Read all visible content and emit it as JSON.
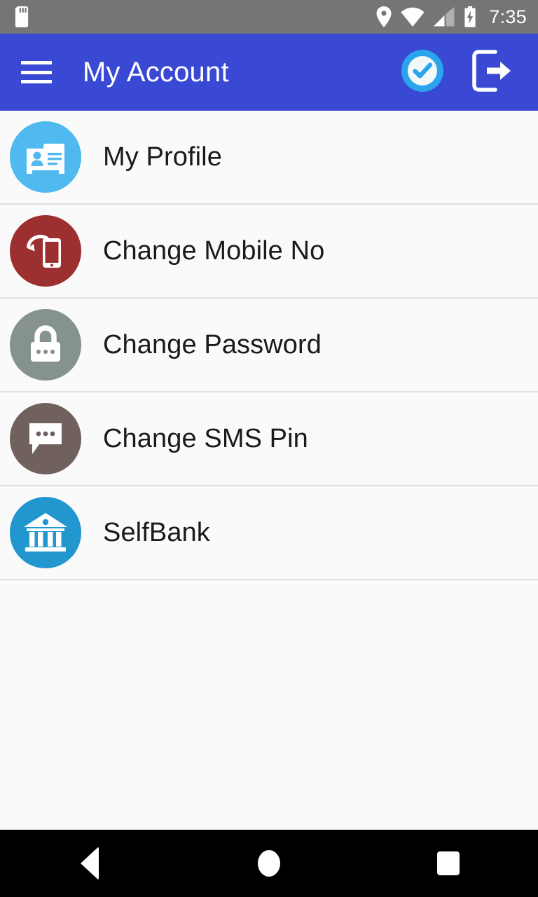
{
  "status_bar": {
    "background_color": "#757575",
    "time": "7:35",
    "left_icons": [
      {
        "name": "sd-card-icon",
        "label": "SD card"
      }
    ],
    "right_icons": [
      {
        "name": "location-pin-icon",
        "label": "Location"
      },
      {
        "name": "wifi-icon",
        "label": "Wi-Fi"
      },
      {
        "name": "cellular-signal-icon",
        "label": "Cellular signal"
      },
      {
        "name": "battery-charging-icon",
        "label": "Battery charging"
      }
    ]
  },
  "app_bar": {
    "background_color": "#3949d3",
    "title": "My Account",
    "menu_icon": "hamburger-menu-icon",
    "actions": [
      {
        "name": "verified-check-button",
        "icon": "check-circle-icon",
        "color": "#29a8ef"
      },
      {
        "name": "logout-button",
        "icon": "exit-to-app-icon",
        "color": "#ffffff"
      }
    ]
  },
  "list": {
    "background_color": "#fafafa",
    "divider_color": "#e0e0e0",
    "items": [
      {
        "label": "My Profile",
        "icon": "contact-card-icon",
        "icon_bg": "#4fb9f0",
        "name": "list-item-my-profile"
      },
      {
        "label": "Change Mobile No",
        "icon": "phone-rotate-icon",
        "icon_bg": "#9c2f30",
        "name": "list-item-change-mobile-no"
      },
      {
        "label": "Change Password",
        "icon": "lock-icon",
        "icon_bg": "#869290",
        "name": "list-item-change-password"
      },
      {
        "label": "Change SMS Pin",
        "icon": "chat-bubble-icon",
        "icon_bg": "#70605e",
        "name": "list-item-change-sms-pin"
      },
      {
        "label": "SelfBank",
        "icon": "bank-building-icon",
        "icon_bg": "#2196cf",
        "name": "list-item-selfbank"
      }
    ]
  },
  "nav_bar": {
    "background_color": "#000000",
    "buttons": [
      {
        "name": "nav-back-button",
        "icon": "triangle-back-icon",
        "label": "Back"
      },
      {
        "name": "nav-home-button",
        "icon": "circle-home-icon",
        "label": "Home"
      },
      {
        "name": "nav-recents-button",
        "icon": "square-recents-icon",
        "label": "Recents"
      }
    ]
  }
}
